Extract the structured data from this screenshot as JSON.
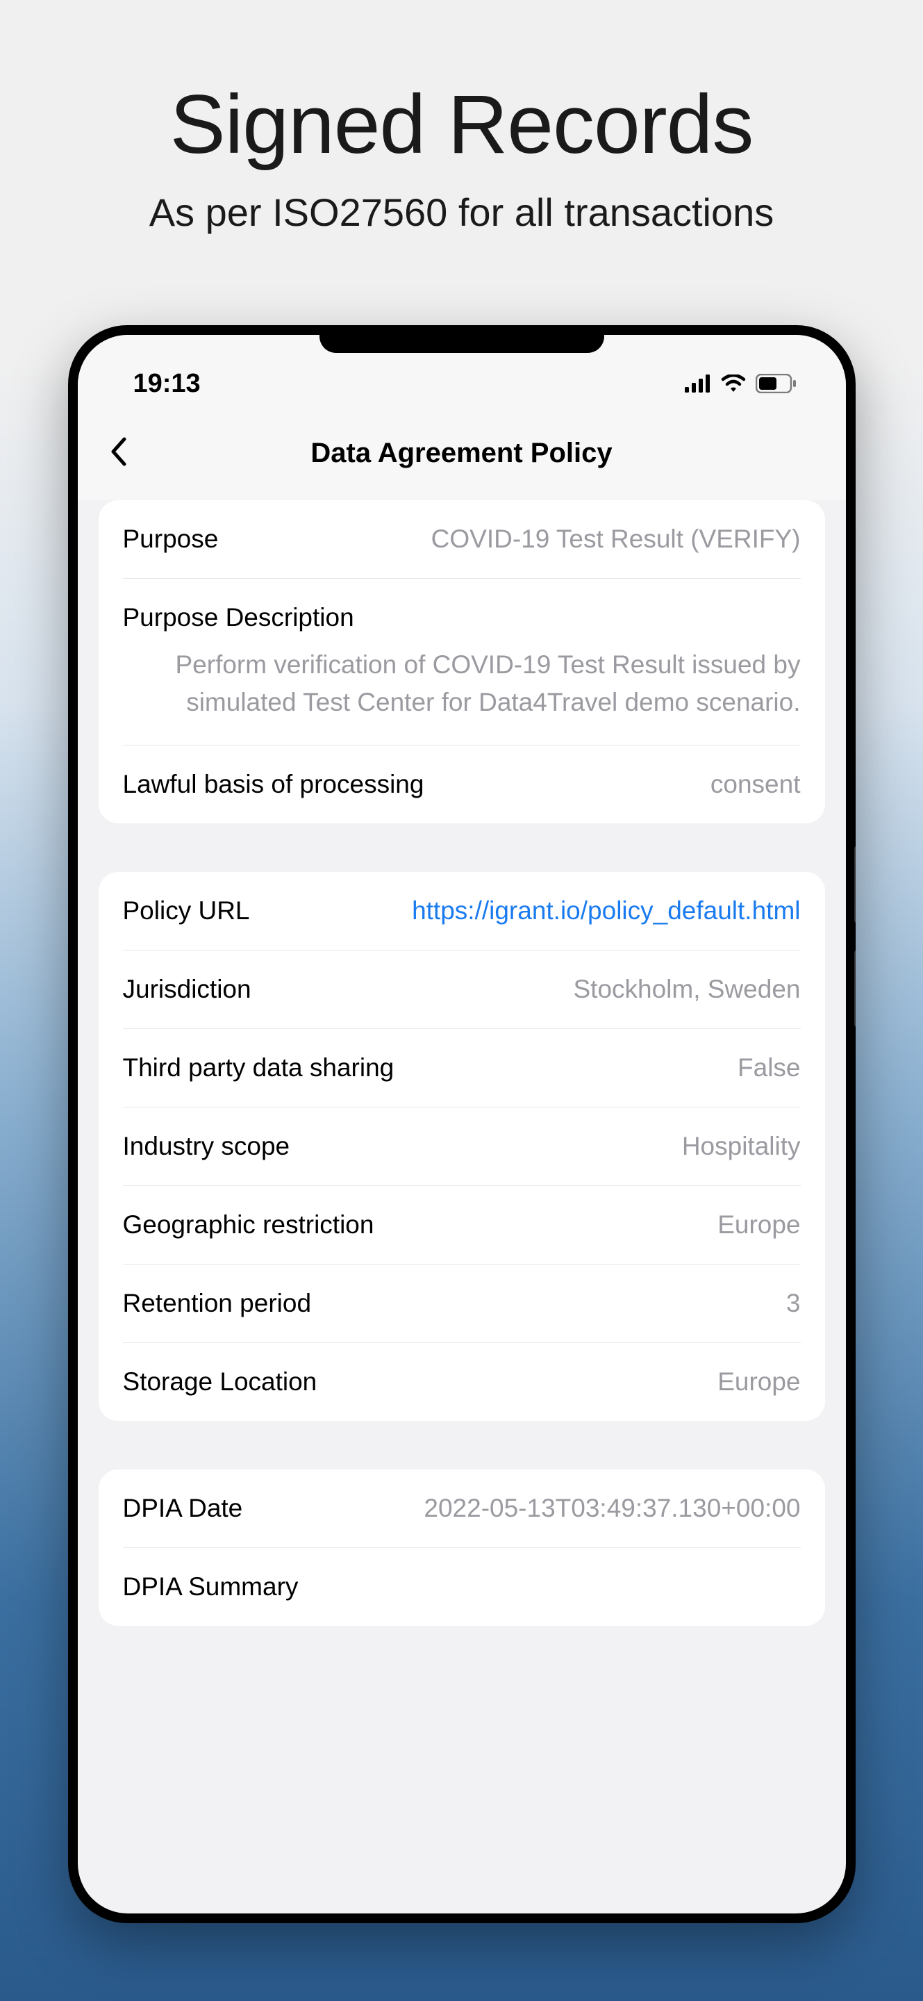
{
  "promo": {
    "title": "Signed Records",
    "subtitle": "As per ISO27560 for all transactions"
  },
  "status": {
    "time": "19:13"
  },
  "nav": {
    "title": "Data Agreement Policy"
  },
  "card1": {
    "purpose_label": "Purpose",
    "purpose_value": "COVID-19 Test Result (VERIFY)",
    "purpose_desc_label": "Purpose Description",
    "purpose_desc_value": "Perform verification of COVID-19 Test Result issued by simulated Test Center for Data4Travel demo scenario.",
    "lawful_label": "Lawful basis of processing",
    "lawful_value": "consent"
  },
  "card2": {
    "policy_url_label": "Policy URL",
    "policy_url_value": "https://igrant.io/policy_default.html",
    "jurisdiction_label": "Jurisdiction",
    "jurisdiction_value": "Stockholm, Sweden",
    "third_party_label": "Third party data sharing",
    "third_party_value": "False",
    "industry_label": "Industry scope",
    "industry_value": "Hospitality",
    "geo_label": "Geographic restriction",
    "geo_value": "Europe",
    "retention_label": "Retention period",
    "retention_value": "3",
    "storage_label": "Storage Location",
    "storage_value": "Europe"
  },
  "card3": {
    "dpia_date_label": "DPIA Date",
    "dpia_date_value": "2022-05-13T03:49:37.130+00:00",
    "dpia_summary_label": "DPIA Summary"
  }
}
